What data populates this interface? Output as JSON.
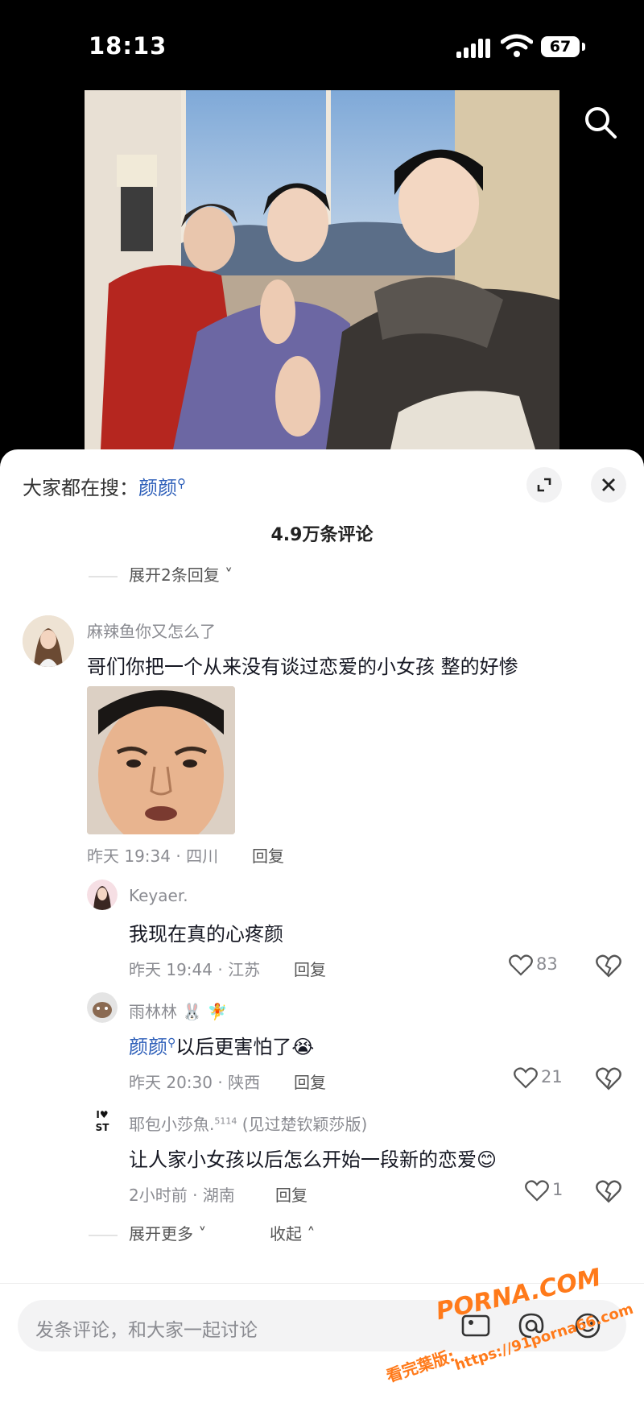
{
  "status": {
    "time": "18:13",
    "battery": "67"
  },
  "sheet": {
    "hot_search_prefix": "大家都在搜：",
    "hot_search_keyword": "颜颜",
    "comment_count": "4.9万条评论",
    "expand_top": "展开2条回复"
  },
  "comments": {
    "main": {
      "user": "麻辣鱼你又怎么了",
      "text": "哥们你把一个从来没有谈过恋爱的小女孩 整的好惨",
      "meta": "昨天 19:34 · 四川",
      "reply": "回复"
    },
    "replies": [
      {
        "user": "Keyaer.",
        "text": "我现在真的心疼颜",
        "meta": "昨天 19:44 · 江苏",
        "reply": "回复",
        "likes": "83"
      },
      {
        "user": "雨林林",
        "user_emoji": "🐰 🧚",
        "keyword": "颜颜",
        "text": "以后更害怕了",
        "emoji": "😭",
        "meta": "昨天 20:30 · 陕西",
        "reply": "回复",
        "likes": "21"
      },
      {
        "user": "耶包小莎魚.",
        "user_sup": "5114",
        "user_note": " (见过楚钦颖莎版)",
        "text": "让人家小女孩以后怎么开始一段新的恋爱",
        "emoji": "😊",
        "meta": "2小时前 · 湖南",
        "reply": "回复",
        "likes": "1"
      }
    ],
    "expand_more": "展开更多",
    "collapse": "收起"
  },
  "input": {
    "placeholder": "发条评论，和大家一起讨论"
  },
  "watermark": {
    "logo": "PORNA.COM",
    "url": "https://91porna66.com",
    "caption": "看完葉版:"
  },
  "colors": {
    "link": "#2b5db8",
    "gray": "#8a8b91",
    "watermark": "#ff7a1a"
  }
}
